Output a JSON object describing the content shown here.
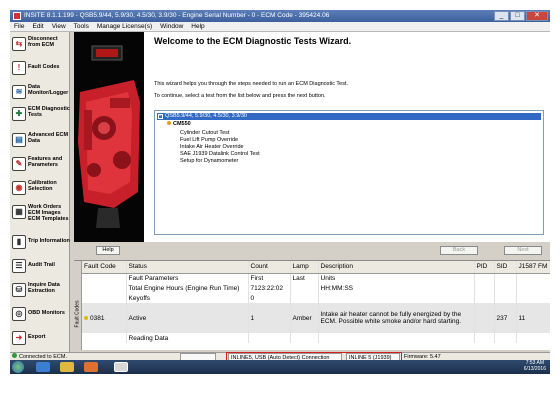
{
  "window": {
    "title": "INSITE 8.1.1.199 - QSB5.9/44, 5.9/30, 4.5/30, 3.9/30 - Engine Serial Number - 0 - ECM Code - 395424.06",
    "minimize": "_",
    "maximize": "□",
    "close": "✕"
  },
  "menu": [
    "File",
    "Edit",
    "View",
    "Tools",
    "Manage License(s)",
    "Window",
    "Help"
  ],
  "sidebar": {
    "items": [
      {
        "label": "Disconnect from ECM",
        "icon": "disconnect-icon",
        "glyph": "⇆",
        "color": "#c03030"
      },
      {
        "label": "Fault Codes",
        "icon": "fault-codes-icon",
        "glyph": "!",
        "color": "#c03030"
      },
      {
        "label": "Data Monitor/Logger",
        "icon": "data-monitor-icon",
        "glyph": "≋",
        "color": "#2060a0"
      },
      {
        "label": "ECM Diagnostic Tests",
        "icon": "diagnostic-tests-icon",
        "glyph": "✚",
        "color": "#208040"
      },
      {
        "label": "Advanced ECM Data",
        "icon": "advanced-data-icon",
        "glyph": "▤",
        "color": "#2060a0"
      },
      {
        "label": "Features and Parameters",
        "icon": "features-icon",
        "glyph": "✎",
        "color": "#c03030"
      },
      {
        "label": "Calibration Selection",
        "icon": "calibration-icon",
        "glyph": "◉",
        "color": "#c03030"
      },
      {
        "label": "Work Orders ECM Images ECM Templates",
        "icon": "work-orders-icon",
        "glyph": "▦",
        "color": "#303030"
      },
      {
        "label": "Trip Information",
        "icon": "trip-info-icon",
        "glyph": "▮",
        "color": "#303030"
      },
      {
        "label": "Audit Trail",
        "icon": "audit-trail-icon",
        "glyph": "☰",
        "color": "#303030"
      },
      {
        "label": "Inquire Data Extraction",
        "icon": "inquire-icon",
        "glyph": "⛁",
        "color": "#303030"
      },
      {
        "label": "OBD Monitors",
        "icon": "obd-icon",
        "glyph": "◎",
        "color": "#303030"
      },
      {
        "label": "Export",
        "icon": "export-icon",
        "glyph": "➜",
        "color": "#c03030"
      }
    ]
  },
  "wizard": {
    "title": "Welcome to the ECM Diagnostic Tests Wizard.",
    "line1": "This wizard helps you through the steps needed to run an ECM Diagnostic Test.",
    "line2": "To continue, select a test from the list below and press the next button.",
    "tree_root": "QSB5.9/44, 5.9/30, 4.5/30, 3.9/30",
    "tree_ecm": "CM550",
    "tests": [
      "Cylinder Cutout Test",
      "Fuel Lift Pump Override",
      "Intake Air Heater Override",
      "SAE J1939 Datalink Control Test",
      "Setup for Dynamometer"
    ],
    "help_button": "Help",
    "back_button": "Back",
    "next_button": "Next"
  },
  "faults": {
    "side_label": "Fault Codes",
    "columns": [
      "Fault Code",
      "Status",
      "Count",
      "Lamp",
      "Description",
      "PID",
      "SID",
      "J1587 FM"
    ],
    "rows": [
      {
        "code": "",
        "status": "Fault Parameters",
        "count": "First",
        "lamp": "Last",
        "description": "Units",
        "pid": "",
        "sid": "",
        "fmi": ""
      },
      {
        "code": "",
        "status": "Total Engine Hours (Engine Run Time)",
        "count": "7123:22:02",
        "lamp": "",
        "description": "HH:MM:SS",
        "pid": "",
        "sid": "",
        "fmi": ""
      },
      {
        "code": "",
        "status": "Keyoffs",
        "count": "0",
        "lamp": "",
        "description": "",
        "pid": "",
        "sid": "",
        "fmi": ""
      },
      {
        "code": "0381",
        "status": "Active",
        "count": "1",
        "lamp": "Amber",
        "description": "Intake air heater cannot be fully energized by the ECM.  Possible white smoke and/or hard starting.",
        "pid": "",
        "sid": "237",
        "fmi": "11"
      },
      {
        "code": "",
        "status": "Reading Data",
        "count": "",
        "lamp": "",
        "description": "",
        "pid": "",
        "sid": "",
        "fmi": ""
      }
    ]
  },
  "statusbar": {
    "connected": "Connected to ECM.",
    "adapter": "INLINE5, USB (Auto Detect) Connection",
    "protocol": "INLINE 5 (J1939)",
    "firmware": "Firmware: 5.47"
  },
  "taskbar": {
    "time": "7:53 AM",
    "date": "6/13/2016"
  },
  "colors": {
    "accent": "#316ac5",
    "engine_red": "#c8202a",
    "fault_active_bg": "#e6e6e6"
  }
}
